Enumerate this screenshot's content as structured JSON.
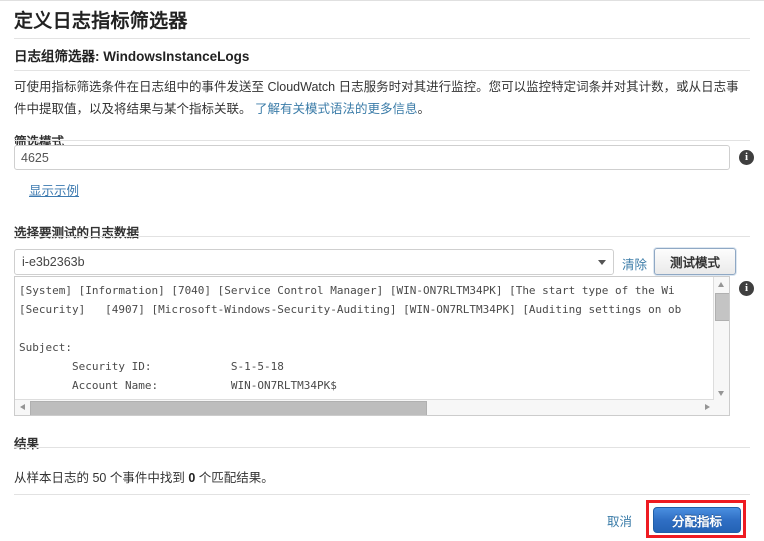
{
  "page": {
    "title": "定义日志指标筛选器",
    "subtitle_prefix": "日志组筛选器: ",
    "subtitle_value": "WindowsInstanceLogs",
    "description_part1": "可使用指标筛选条件在日志组中的事件发送至 CloudWatch 日志服务时对其进行监控。您可以监控特定词条并对其计数，或从日志事件中提取值，以及将结果与某个指标关联。",
    "description_link": "了解有关模式语法的更多信息",
    "description_end": "。"
  },
  "filter_pattern": {
    "label": "筛选模式",
    "value": "4625",
    "placeholder": "",
    "info_icon": "info-icon",
    "show_example_link": "显示示例"
  },
  "log_data": {
    "label": "选择要测试的日志数据",
    "selected": "i-e3b2363b",
    "caret_icon": "chevron-down-icon",
    "clear_label": "清除",
    "test_button_label": "测试模式",
    "info_icon": "info-icon",
    "lines": [
      "[System] [Information] [7040] [Service Control Manager] [WIN-ON7RLTM34PK] [The start type of the Wi",
      "[Security]   [4907] [Microsoft-Windows-Security-Auditing] [WIN-ON7RLTM34PK] [Auditing settings on ob",
      "",
      "Subject:",
      "        Security ID:            S-1-5-18",
      "        Account Name:           WIN-ON7RLTM34PK$"
    ],
    "scrollbar": {
      "vertical_up_icon": "arrow-up-icon",
      "vertical_down_icon": "arrow-down-icon",
      "horizontal_left_icon": "arrow-left-icon",
      "horizontal_right_icon": "arrow-right-icon"
    }
  },
  "results": {
    "label": "结果",
    "text_prefix": "从样本日志的 ",
    "event_count": "50",
    "text_middle": " 个事件中找到 ",
    "match_count": "0",
    "text_suffix": " 个匹配结果。"
  },
  "footer": {
    "cancel_label": "取消",
    "assign_label": "分配指标"
  },
  "colors": {
    "link": "#3b7ca8",
    "primary_button": "#2f6fc4",
    "highlight_box": "#ee1b22",
    "info_icon_bg": "#3f3f3f"
  }
}
